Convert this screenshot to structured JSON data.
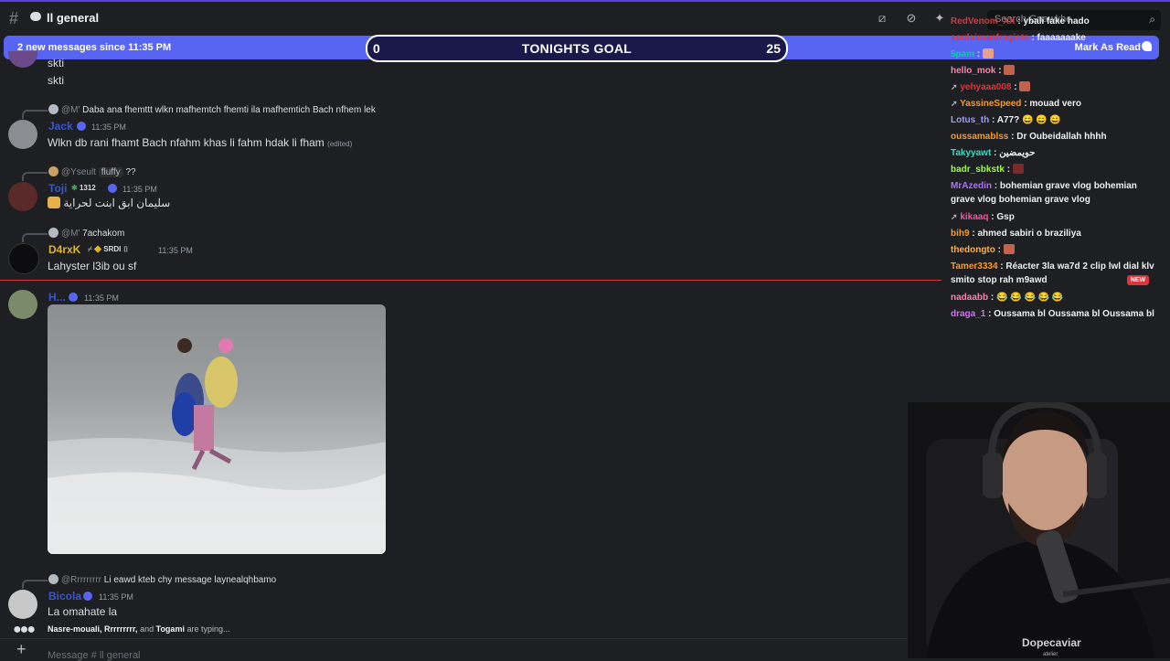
{
  "header": {
    "channel_name": "ll general",
    "search_placeholder": "Search Gnawkhe"
  },
  "new_messages_bar": {
    "text": "2 new messages since 11:35 PM",
    "mark_read": "Mark As Read"
  },
  "goal": {
    "title": "TONIGHTS GOAL",
    "current": "0",
    "target": "25"
  },
  "messages": [
    {
      "text1": "skti",
      "text2": "skti"
    },
    {
      "reply_name": "@M'",
      "reply_text": "Daba ana fhemttt wlkn mafhemtch fhemti ila mafhemtich Bach nfhem lek",
      "name": "Jack",
      "time": "11:35 PM",
      "text": "Wlkn db rani fhamt Bach nfahm khas li fahm hdak li fham",
      "edited": "(edited)"
    },
    {
      "reply_name": "@Yseult",
      "reply_tag": "fluffy",
      "reply_text": "??",
      "name": "Toji",
      "tag": "1312",
      "time": "11:35 PM",
      "text": "سليمان ابق ابنت لحراية"
    },
    {
      "reply_name": "@M'",
      "reply_text": "7achakom",
      "name": "D4rxK",
      "tag": "SRDI",
      "time": "11:35 PM",
      "text": "Lahyster l3ib ou sf"
    },
    {
      "name": "H...",
      "time": "11:35 PM"
    },
    {
      "reply_name": "@Rrrrrrrrr",
      "reply_text": "Li eawd kteb chy message laynealqhbamo",
      "name": "Bicola",
      "time": "11:35 PM",
      "text": "La omahate la"
    }
  ],
  "typing": {
    "users": "Nasre-mouali, Rrrrrrrrr,",
    "and": "and",
    "last": "Togami",
    "suffix": "are typing..."
  },
  "input": {
    "placeholder": "Message # ll general"
  },
  "chat": [
    {
      "user": "RedVenom_XX",
      "color": "#e0343c",
      "msg": "ybali fake hado"
    },
    {
      "user": "soulaimanfragiste",
      "color": "#e0343c",
      "msg": "faaaaaaake"
    },
    {
      "user": "5pam",
      "color": "#00d4a4",
      "msg": ""
    },
    {
      "user": "hello_mok",
      "color": "#ff7fb0",
      "msg": ""
    },
    {
      "user": "yehyaaa008",
      "color": "#e0343c",
      "msg": ""
    },
    {
      "user": "YassineSpeed",
      "color": "#ff9a1f",
      "msg": "mouad vero"
    },
    {
      "user": "Lotus_th",
      "color": "#9c9cff",
      "msg": "A77? 😄 😄 😄"
    },
    {
      "user": "oussamablss",
      "color": "#ff9a1f",
      "msg": "Dr Oubeidallah hhhh"
    },
    {
      "user": "Takyyawt",
      "color": "#2ee0c8",
      "msg": "حويمضين"
    },
    {
      "user": "badr_sbkstk",
      "color": "#9aff3a",
      "msg": ""
    },
    {
      "user": "MrAzedin",
      "color": "#b26cff",
      "msg": "bohemian grave vlog bohemian grave vlog bohemian grave vlog"
    },
    {
      "user": "kikaaq",
      "color": "#ff4fa0",
      "msg": "Gsp"
    },
    {
      "user": "bih9",
      "color": "#ff9a1f",
      "msg": "ahmed sabiri o braziliya"
    },
    {
      "user": "thedongto",
      "color": "#ffb03a",
      "msg": ""
    },
    {
      "user": "Tamer3334",
      "color": "#ff9a1f",
      "msg": "Réacter 3la wa7d 2 clip lwl dial klv smito stop rah m9awd"
    },
    {
      "user": "nadaabb",
      "color": "#ff7fb0",
      "msg": "😂 😂 😂 😂 😂"
    },
    {
      "user": "draga_1",
      "color": "#d66cff",
      "msg": "Oussama bl Oussama bl Oussama bl"
    }
  ],
  "chat_new_tag": "NEW",
  "webcam": {
    "shirt_text": "Dopecaviar",
    "shirt_sub": "atelier"
  }
}
